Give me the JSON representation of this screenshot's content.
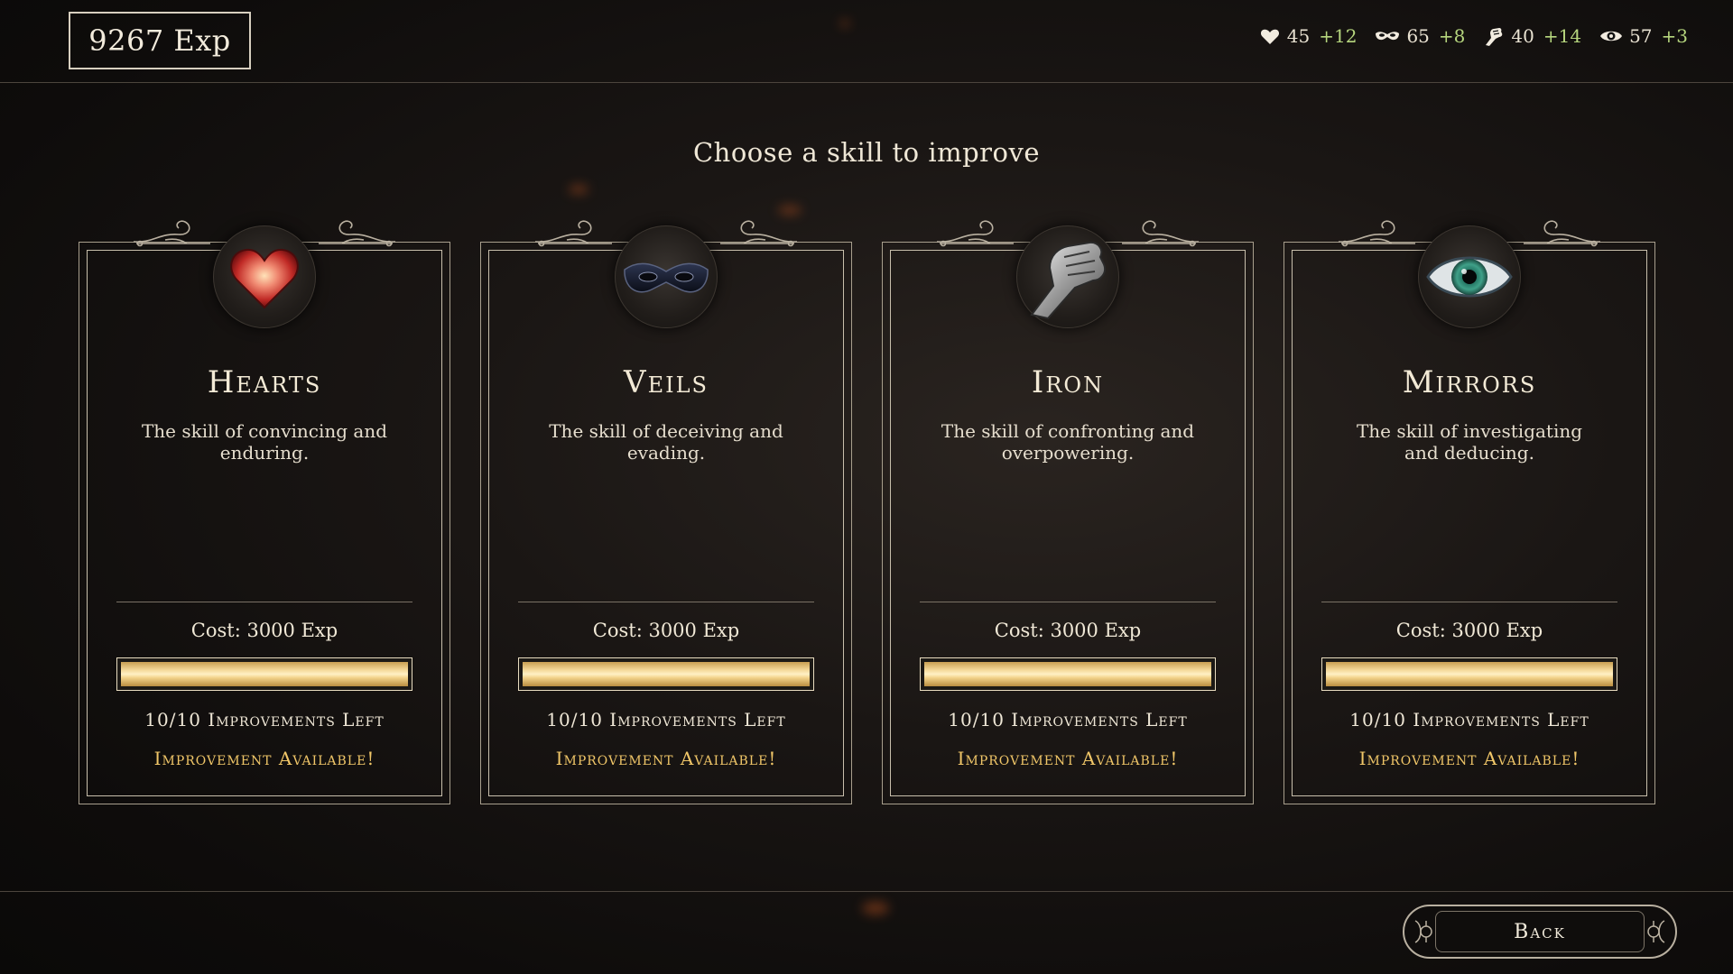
{
  "header": {
    "exp": "9267 Exp",
    "stats": [
      {
        "icon": "heart-icon",
        "value": "45",
        "bonus": "+12"
      },
      {
        "icon": "mask-icon",
        "value": "65",
        "bonus": "+8"
      },
      {
        "icon": "fist-icon",
        "value": "40",
        "bonus": "+14"
      },
      {
        "icon": "eye-icon",
        "value": "57",
        "bonus": "+3"
      }
    ]
  },
  "heading": "Choose a skill to improve",
  "skills": [
    {
      "name": "Hearts",
      "icon": "heart-icon",
      "description": "The skill of convincing and enduring.",
      "cost": "Cost: 3000 Exp",
      "progress": 1.0,
      "improvements": "10/10 Improvements Left",
      "status": "Improvement Available!"
    },
    {
      "name": "Veils",
      "icon": "mask-icon",
      "description": "The skill of deceiving and evading.",
      "cost": "Cost: 3000 Exp",
      "progress": 1.0,
      "improvements": "10/10 Improvements Left",
      "status": "Improvement Available!"
    },
    {
      "name": "Iron",
      "icon": "fist-icon",
      "description": "The skill of confronting and overpowering.",
      "cost": "Cost: 3000 Exp",
      "progress": 1.0,
      "improvements": "10/10 Improvements Left",
      "status": "Improvement Available!"
    },
    {
      "name": "Mirrors",
      "icon": "eye-icon",
      "description": "The skill of investigating and deducing.",
      "cost": "Cost: 3000 Exp",
      "progress": 1.0,
      "improvements": "10/10 Improvements Left",
      "status": "Improvement Available!"
    }
  ],
  "footer": {
    "back_label": "Back"
  },
  "colors": {
    "accent_gold": "#f0c668",
    "bonus_green": "#b6d67e",
    "frame": "#c8bfac",
    "background": "#1a1614"
  }
}
